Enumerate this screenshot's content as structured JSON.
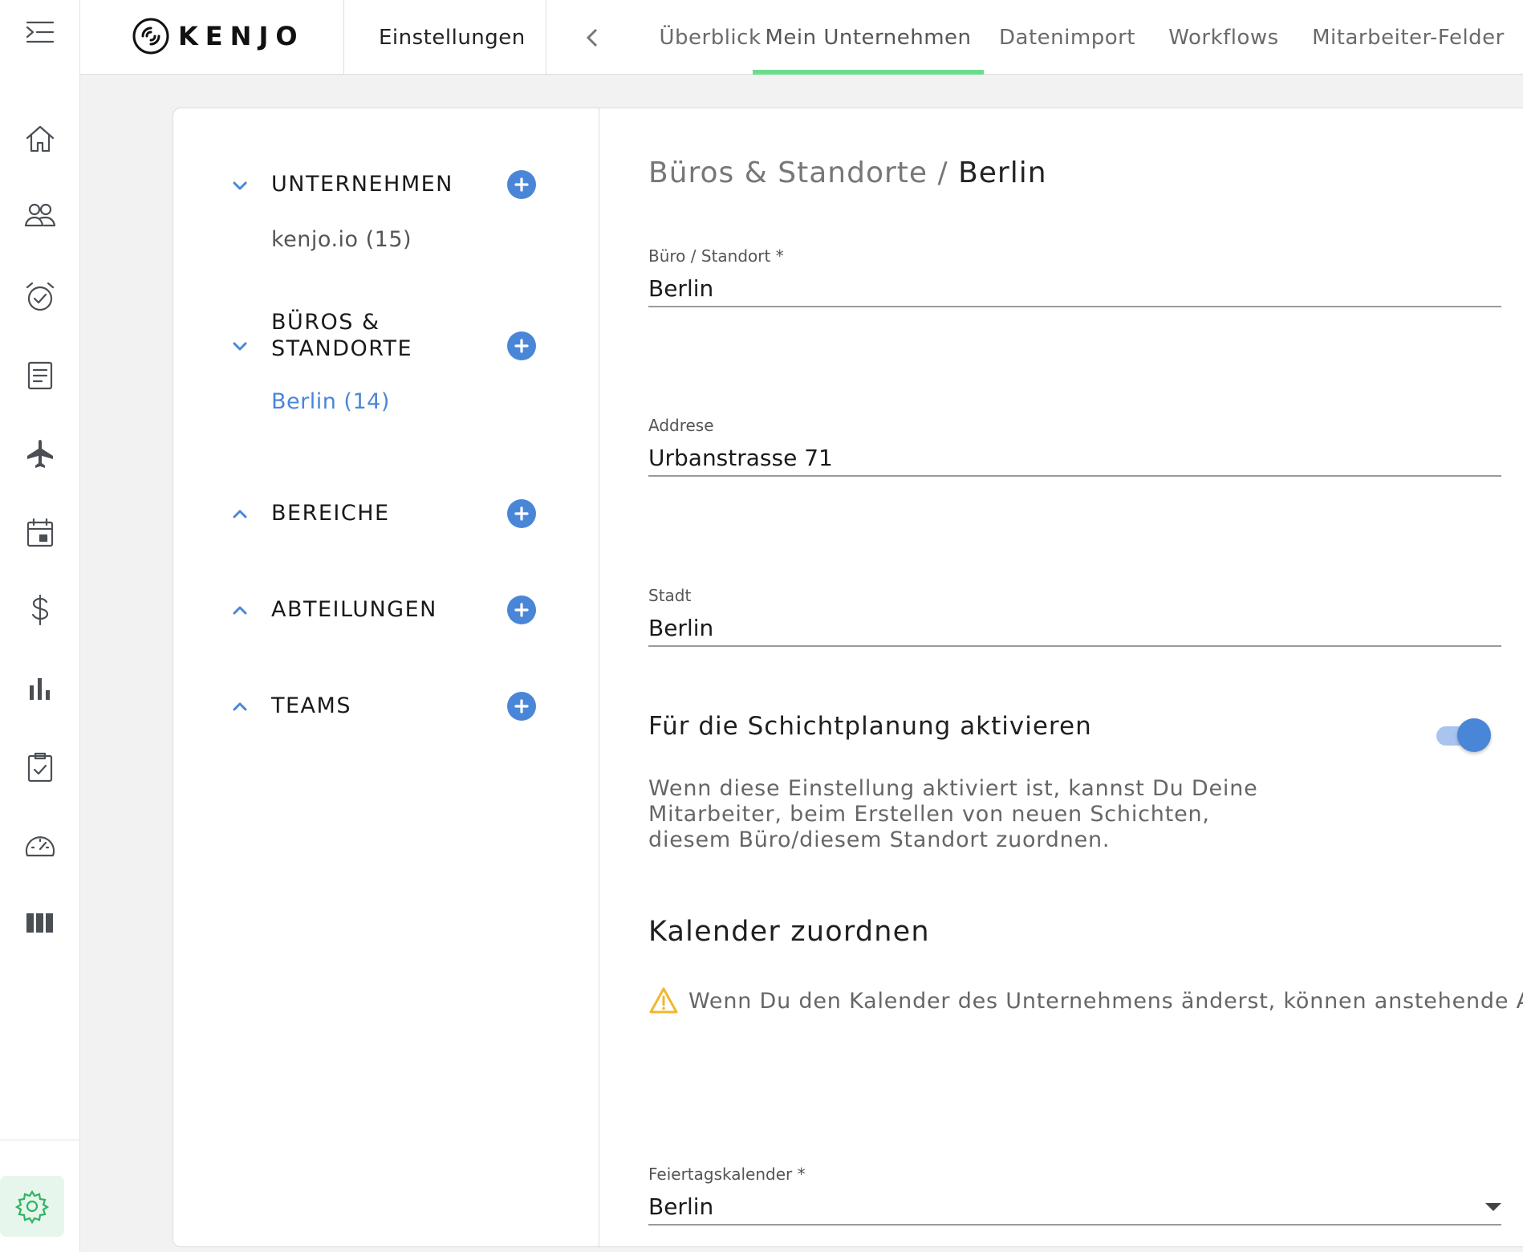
{
  "brand": {
    "name": "KENJO",
    "accent": "#4a86d8",
    "active_tab_color": "#6edc8f",
    "settings_green": "#2fb463"
  },
  "rail": {
    "menu_icon": "menu-collapse-icon",
    "items": [
      {
        "icon": "home-icon"
      },
      {
        "icon": "people-icon"
      },
      {
        "icon": "alarm-clock-icon"
      },
      {
        "icon": "document-icon"
      },
      {
        "icon": "airplane-icon"
      },
      {
        "icon": "calendar-icon"
      },
      {
        "icon": "dollar-icon"
      },
      {
        "icon": "bar-chart-icon"
      },
      {
        "icon": "clipboard-check-icon"
      },
      {
        "icon": "speedometer-icon"
      },
      {
        "icon": "columns-icon"
      }
    ],
    "settings_icon": "gear-icon"
  },
  "header": {
    "section": "Einstellungen",
    "tabs": [
      {
        "label": "Überblick"
      },
      {
        "label": "Mein Unternehmen",
        "active": true
      },
      {
        "label": "Datenimport"
      },
      {
        "label": "Workflows"
      },
      {
        "label": "Mitarbeiter-Felder"
      }
    ]
  },
  "tree": {
    "groups": [
      {
        "label": "UNTERNEHMEN",
        "expanded": true,
        "children": [
          "kenjo.io (15)"
        ]
      },
      {
        "label": "BÜROS & STANDORTE",
        "expanded": true,
        "children": [
          "Berlin (14)"
        ],
        "selected_child": "Berlin (14)"
      },
      {
        "label": "BEREICHE",
        "expanded": false,
        "children": []
      },
      {
        "label": "ABTEILUNGEN",
        "expanded": false,
        "children": []
      },
      {
        "label": "TEAMS",
        "expanded": false,
        "children": []
      }
    ]
  },
  "detail": {
    "breadcrumb_parent": "Büros & Standorte",
    "breadcrumb_separator": " / ",
    "breadcrumb_current": "Berlin",
    "fields": {
      "office": {
        "label": "Büro / Standort *",
        "value": "Berlin"
      },
      "address": {
        "label": "Addrese",
        "value": "Urbanstrasse 71"
      },
      "city": {
        "label": "Stadt",
        "value": "Berlin"
      }
    },
    "shift_planning": {
      "label": "Für die Schichtplanung aktivieren",
      "enabled": true,
      "help": "Wenn diese Einstellung aktiviert ist, kannst Du Deine Mitarbeiter, beim Erstellen von neuen Schichten, diesem Büro/diesem Standort zuordnen."
    },
    "calendar_section": {
      "title": "Kalender zuordnen",
      "warning": "Wenn Du den Kalender des Unternehmens änderst, können anstehende Abwe",
      "holiday_calendar": {
        "label": "Feiertagskalender *",
        "value": "Berlin"
      }
    }
  }
}
